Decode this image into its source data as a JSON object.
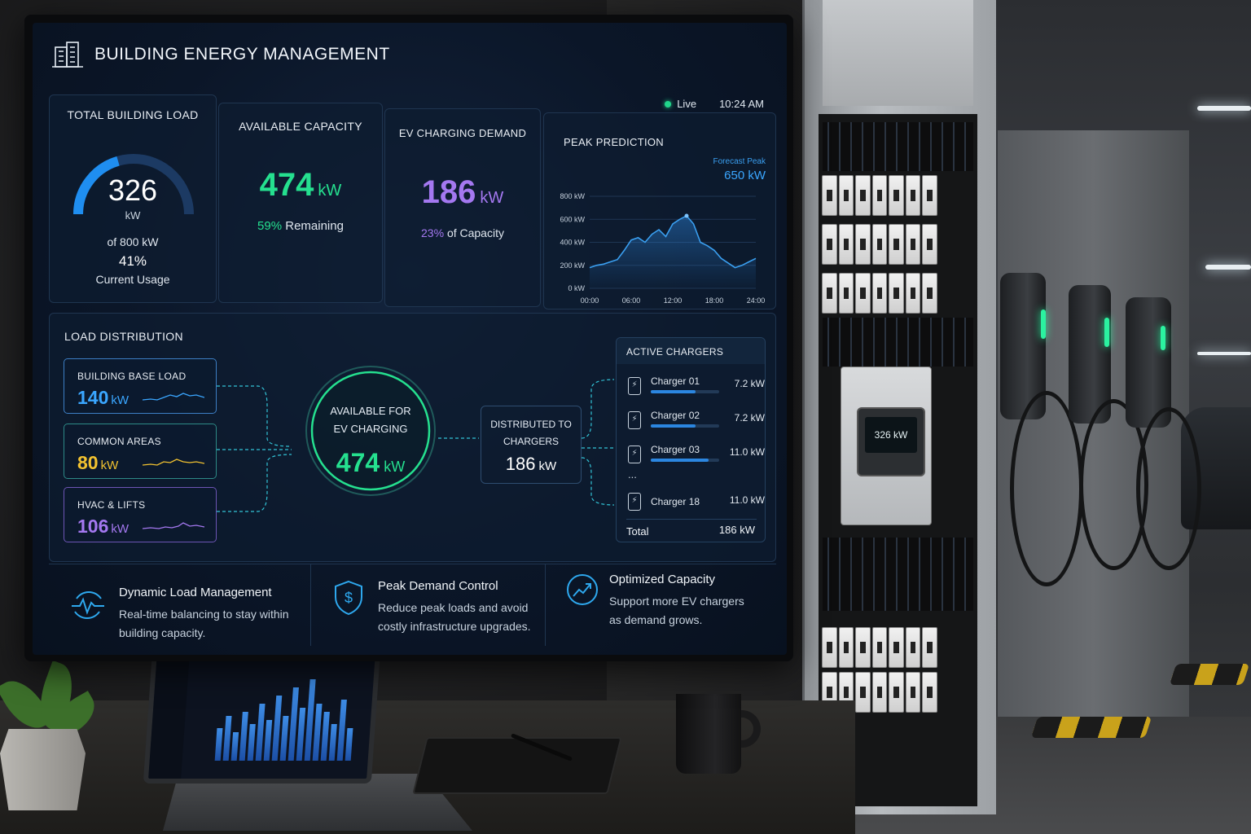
{
  "header": {
    "title": "BUILDING ENERGY MANAGEMENT"
  },
  "status": {
    "live_label": "Live",
    "time": "10:24 AM"
  },
  "total_load": {
    "title": "TOTAL BUILDING LOAD",
    "value": "326",
    "unit": "kW",
    "of_label": "of 800 kW",
    "percent": "41%",
    "usage_label": "Current Usage",
    "gauge_fraction": 0.41
  },
  "available_capacity": {
    "title": "AVAILABLE CAPACITY",
    "value": "474",
    "unit": "kW",
    "percent": "59%",
    "remaining_label": "Remaining"
  },
  "ev_demand": {
    "title": "EV CHARGING DEMAND",
    "value": "186",
    "unit": "kW",
    "percent": "23%",
    "capacity_label": "of Capacity"
  },
  "peak_prediction": {
    "title": "PEAK PREDICTION",
    "forecast_label": "Forecast Peak",
    "forecast_value": "650 kW"
  },
  "chart_data": {
    "type": "line",
    "title": "PEAK PREDICTION",
    "x_ticks": [
      "00:00",
      "06:00",
      "12:00",
      "18:00",
      "24:00"
    ],
    "y_ticks": [
      "800 kW",
      "600 kW",
      "400 kW",
      "200 kW",
      "0 kW"
    ],
    "ylim": [
      0,
      800
    ],
    "xlim": [
      0,
      24
    ],
    "x": [
      0,
      1,
      2,
      3,
      4,
      5,
      6,
      7,
      8,
      9,
      10,
      11,
      12,
      13,
      14,
      15,
      16,
      17,
      18,
      19,
      20,
      21,
      22,
      23,
      24
    ],
    "values": [
      180,
      200,
      210,
      230,
      250,
      330,
      420,
      440,
      400,
      470,
      510,
      450,
      560,
      600,
      630,
      560,
      400,
      370,
      330,
      260,
      220,
      180,
      200,
      230,
      260
    ],
    "annotation": "Forecast Peak 650 kW",
    "color": "#3a9ff0"
  },
  "load_distribution": {
    "title": "LOAD DISTRIBUTION",
    "sources": [
      {
        "label": "BUILDING BASE LOAD",
        "value": "140",
        "unit": "kW",
        "color": "#3aa6ff"
      },
      {
        "label": "COMMON AREAS",
        "value": "80",
        "unit": "kW",
        "color": "#f2c230"
      },
      {
        "label": "HVAC & LIFTS",
        "value": "106",
        "unit": "kW",
        "color": "#a478f0"
      }
    ],
    "center": {
      "line1": "AVAILABLE FOR",
      "line2": "EV CHARGING",
      "value": "474",
      "unit": "kW"
    },
    "distributed": {
      "line1": "DISTRIBUTED TO",
      "line2": "CHARGERS",
      "value": "186",
      "unit": "kW"
    }
  },
  "active_chargers": {
    "title": "ACTIVE CHARGERS",
    "rows": [
      {
        "name": "Charger 01",
        "kw": "7.2 kW",
        "fill": 0.65
      },
      {
        "name": "Charger 02",
        "kw": "7.2 kW",
        "fill": 0.65
      },
      {
        "name": "Charger 03",
        "kw": "11.0 kW",
        "fill": 0.85
      },
      {
        "name": "Charger 18",
        "kw": "11.0 kW",
        "fill": 0
      }
    ],
    "ellipsis": "...",
    "total_label": "Total",
    "total_value": "186 kW"
  },
  "features": [
    {
      "title": "Dynamic Load Management",
      "desc1": "Real-time balancing to stay within",
      "desc2": "building capacity.",
      "icon": "pulse-icon"
    },
    {
      "title": "Peak Demand Control",
      "desc1": "Reduce peak loads and avoid",
      "desc2": "costly infrastructure upgrades.",
      "icon": "shield-dollar-icon"
    },
    {
      "title": "Optimized Capacity",
      "desc1": "Support more EV chargers",
      "desc2": "as demand grows.",
      "icon": "trend-up-icon"
    }
  ],
  "meter": {
    "reading": "326 kW"
  },
  "colors": {
    "green": "#25e08f",
    "purple": "#a478f0",
    "blue": "#2b86e0",
    "teal": "#32c3d6"
  }
}
